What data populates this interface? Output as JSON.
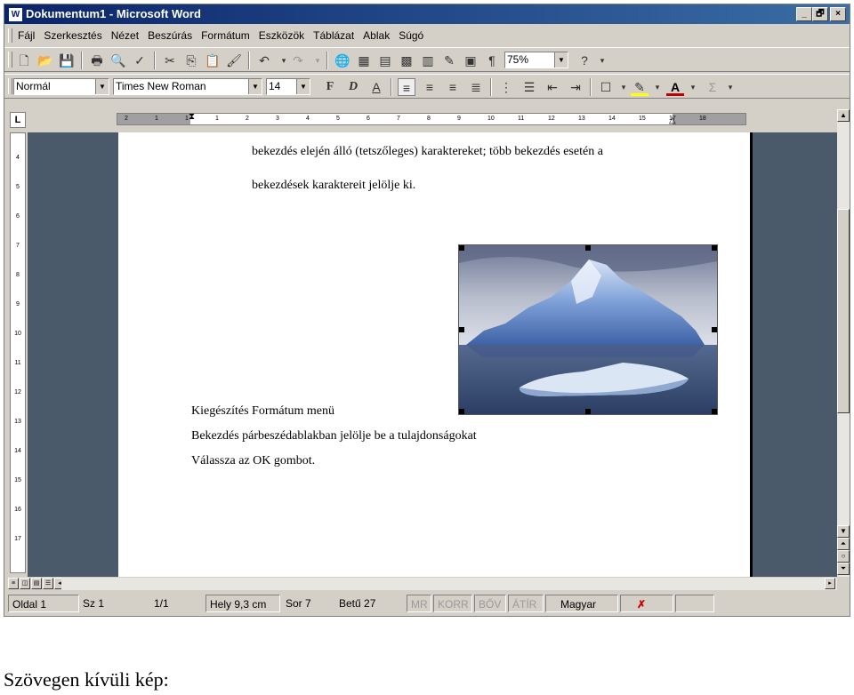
{
  "window": {
    "title": "Dokumentum1 - Microsoft Word",
    "app_icon": "W",
    "controls": {
      "minimize": "_",
      "maximize": "🗗",
      "close": "×"
    }
  },
  "menu": {
    "items": [
      "Fájl",
      "Szerkesztés",
      "Nézet",
      "Beszúrás",
      "Formátum",
      "Eszközök",
      "Táblázat",
      "Ablak",
      "Súgó"
    ]
  },
  "standard_toolbar": {
    "zoom": "75%"
  },
  "format_toolbar": {
    "style": "Normál",
    "font": "Times New Roman",
    "size": "14",
    "bold": "F",
    "italic": "D",
    "underline": "A",
    "sum": "Σ"
  },
  "hruler": {
    "ticks": [
      "2",
      "1",
      "1",
      "1",
      "2",
      "3",
      "4",
      "5",
      "6",
      "7",
      "8",
      "9",
      "10",
      "11",
      "12",
      "13",
      "14",
      "15",
      "17",
      "18"
    ]
  },
  "vruler": {
    "ticks": [
      "4",
      "5",
      "6",
      "7",
      "8",
      "9",
      "10",
      "11",
      "12",
      "13",
      "14",
      "15",
      "16",
      "17"
    ]
  },
  "document": {
    "line1": "bekezdés elején álló (tetszőleges) karaktereket; több bekezdés esetén a",
    "line2": "bekezdések karaktereit jelölje ki.",
    "line3": "Kiegészítés Formátum menü",
    "line4": "Bekezdés párbeszédablakban jelölje be a tulajdonságokat",
    "line5": "Válassza az OK gombot."
  },
  "statusbar": {
    "page": "Oldal 1",
    "section": "Sz 1",
    "pages": "1/1",
    "position": "Hely 9,3 cm",
    "row": "Sor 7",
    "col": "Betű 27",
    "mr": "MR",
    "korr": "KORR",
    "bov": "BŐV",
    "atir": "ÁTÍR",
    "language": "Magyar"
  },
  "caption": "Szövegen kívüli kép:"
}
